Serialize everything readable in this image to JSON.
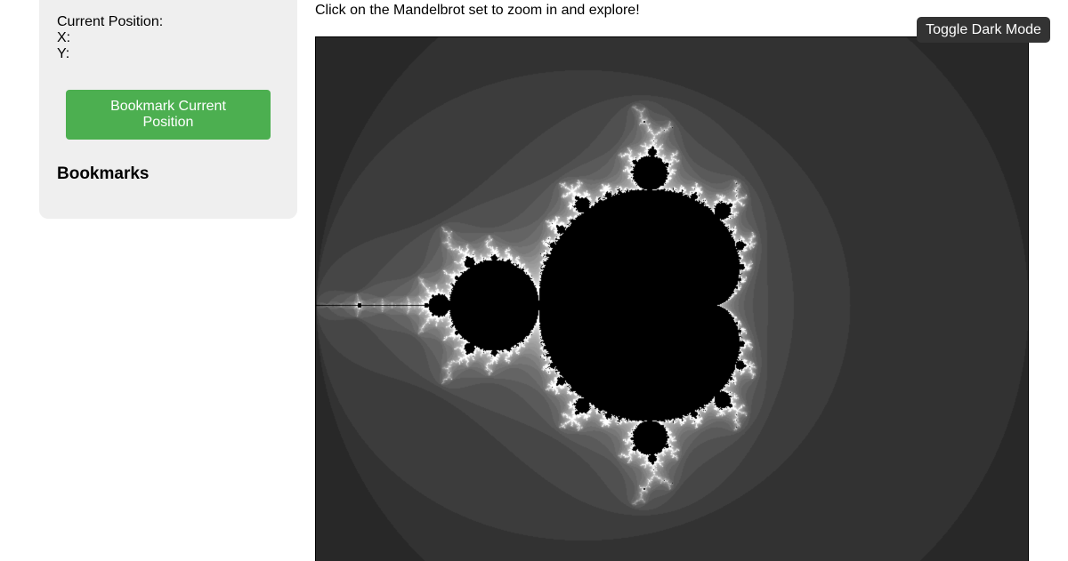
{
  "sidebar": {
    "position": {
      "heading": "Current Position:",
      "x_label": "X:",
      "y_label": "Y:"
    },
    "bookmark_button": "Bookmark Current Position",
    "bookmarks_heading": "Bookmarks"
  },
  "main": {
    "instructions": "Click on the Mandelbrot set to zoom in and explore!",
    "toggle_dark_mode": "Toggle Dark Mode"
  },
  "colors": {
    "sidebar_bg": "#efefef",
    "bookmark_button_bg": "#4caf50",
    "toggle_button_bg": "#333333",
    "fractal_outside": "#1e1e1e",
    "fractal_set": "#000000"
  }
}
